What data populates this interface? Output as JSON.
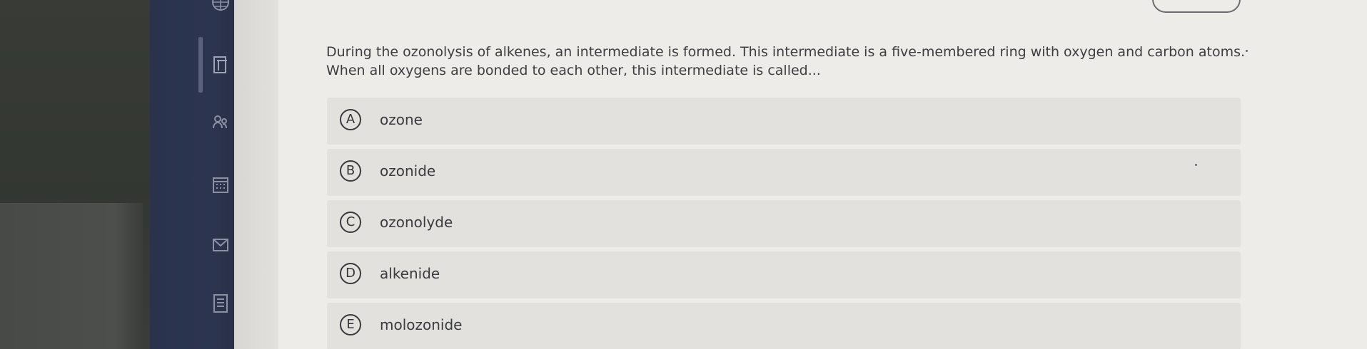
{
  "question": {
    "text": "During the ozonolysis of alkenes, an intermediate is formed. This intermediate is a five-membered ring with oxygen and carbon atoms. When all oxygens are bonded to each other, this intermediate is called..."
  },
  "options": [
    {
      "letter": "A",
      "text": "ozone"
    },
    {
      "letter": "B",
      "text": "ozonide"
    },
    {
      "letter": "C",
      "text": "ozonolyde"
    },
    {
      "letter": "D",
      "text": "alkenide"
    },
    {
      "letter": "E",
      "text": "molozonide"
    }
  ],
  "sidebar": {
    "icons": [
      "globe-icon",
      "document-icon",
      "users-icon",
      "calendar-icon",
      "mail-icon",
      "list-icon"
    ]
  },
  "colors": {
    "rail": "#2c3550",
    "content_bg": "#eeece9",
    "option_bg": "#e3e1de",
    "text": "#3d3e42"
  }
}
